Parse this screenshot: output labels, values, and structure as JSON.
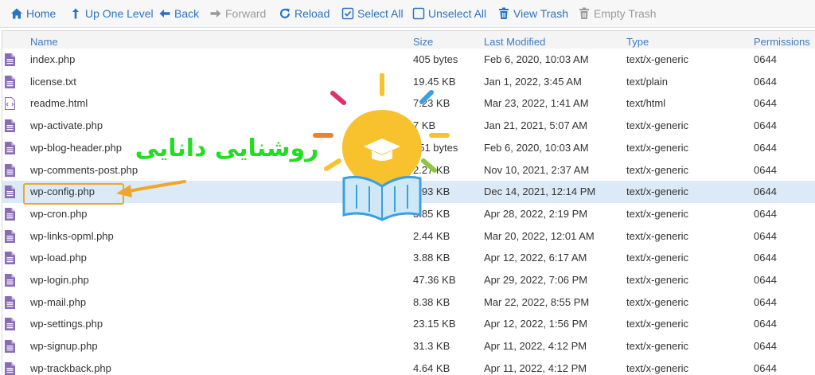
{
  "toolbar": {
    "home": "Home",
    "up_one_level": "Up One Level",
    "back": "Back",
    "forward": "Forward",
    "reload": "Reload",
    "select_all": "Select All",
    "unselect_all": "Unselect All",
    "view_trash": "View Trash",
    "empty_trash": "Empty Trash"
  },
  "columns": {
    "name": "Name",
    "size": "Size",
    "last_modified": "Last Modified",
    "type": "Type",
    "permissions": "Permissions"
  },
  "files": [
    {
      "name": "index.php",
      "size": "405 bytes",
      "modified": "Feb 6, 2020, 10:03 AM",
      "type": "text/x-generic",
      "perm": "0644",
      "icon": "php-file-icon"
    },
    {
      "name": "license.txt",
      "size": "19.45 KB",
      "modified": "Jan 1, 2022, 3:45 AM",
      "type": "text/plain",
      "perm": "0644",
      "icon": "text-file-icon"
    },
    {
      "name": "readme.html",
      "size": "7.23 KB",
      "modified": "Mar 23, 2022, 1:41 AM",
      "type": "text/html",
      "perm": "0644",
      "icon": "html-file-icon"
    },
    {
      "name": "wp-activate.php",
      "size": "7 KB",
      "modified": "Jan 21, 2021, 5:07 AM",
      "type": "text/x-generic",
      "perm": "0644",
      "icon": "php-file-icon"
    },
    {
      "name": "wp-blog-header.php",
      "size": "351 bytes",
      "modified": "Feb 6, 2020, 10:03 AM",
      "type": "text/x-generic",
      "perm": "0644",
      "icon": "php-file-icon"
    },
    {
      "name": "wp-comments-post.php",
      "size": "2.27 KB",
      "modified": "Nov 10, 2021, 2:37 AM",
      "type": "text/x-generic",
      "perm": "0644",
      "icon": "php-file-icon"
    },
    {
      "name": "wp-config.php",
      "size": "2.93 KB",
      "modified": "Dec 14, 2021, 12:14 PM",
      "type": "text/x-generic",
      "perm": "0644",
      "icon": "php-file-icon"
    },
    {
      "name": "wp-cron.php",
      "size": "3.85 KB",
      "modified": "Apr 28, 2022, 2:19 PM",
      "type": "text/x-generic",
      "perm": "0644",
      "icon": "php-file-icon"
    },
    {
      "name": "wp-links-opml.php",
      "size": "2.44 KB",
      "modified": "Mar 20, 2022, 12:01 AM",
      "type": "text/x-generic",
      "perm": "0644",
      "icon": "php-file-icon"
    },
    {
      "name": "wp-load.php",
      "size": "3.88 KB",
      "modified": "Apr 12, 2022, 6:17 AM",
      "type": "text/x-generic",
      "perm": "0644",
      "icon": "php-file-icon"
    },
    {
      "name": "wp-login.php",
      "size": "47.36 KB",
      "modified": "Apr 29, 2022, 7:06 PM",
      "type": "text/x-generic",
      "perm": "0644",
      "icon": "php-file-icon"
    },
    {
      "name": "wp-mail.php",
      "size": "8.38 KB",
      "modified": "Mar 22, 2022, 8:55 PM",
      "type": "text/x-generic",
      "perm": "0644",
      "icon": "php-file-icon"
    },
    {
      "name": "wp-settings.php",
      "size": "23.15 KB",
      "modified": "Apr 12, 2022, 1:56 PM",
      "type": "text/x-generic",
      "perm": "0644",
      "icon": "php-file-icon"
    },
    {
      "name": "wp-signup.php",
      "size": "31.3 KB",
      "modified": "Apr 11, 2022, 4:12 PM",
      "type": "text/x-generic",
      "perm": "0644",
      "icon": "php-file-icon"
    },
    {
      "name": "wp-trackback.php",
      "size": "4.64 KB",
      "modified": "Apr 11, 2022, 4:12 PM",
      "type": "text/x-generic",
      "perm": "0644",
      "icon": "php-file-icon"
    }
  ],
  "selected_row": "wp-config.php",
  "watermark": {
    "text": "روشنایی دانایی",
    "text_color": "#22dd22",
    "bulb_color": "#f7c22e"
  },
  "colors": {
    "accent": "#2a73c4",
    "header_text": "#3a7cc6",
    "selected_row": "#dbeaf6",
    "highlight": "#f0a62a",
    "file_icon": "#8a6cb5"
  }
}
